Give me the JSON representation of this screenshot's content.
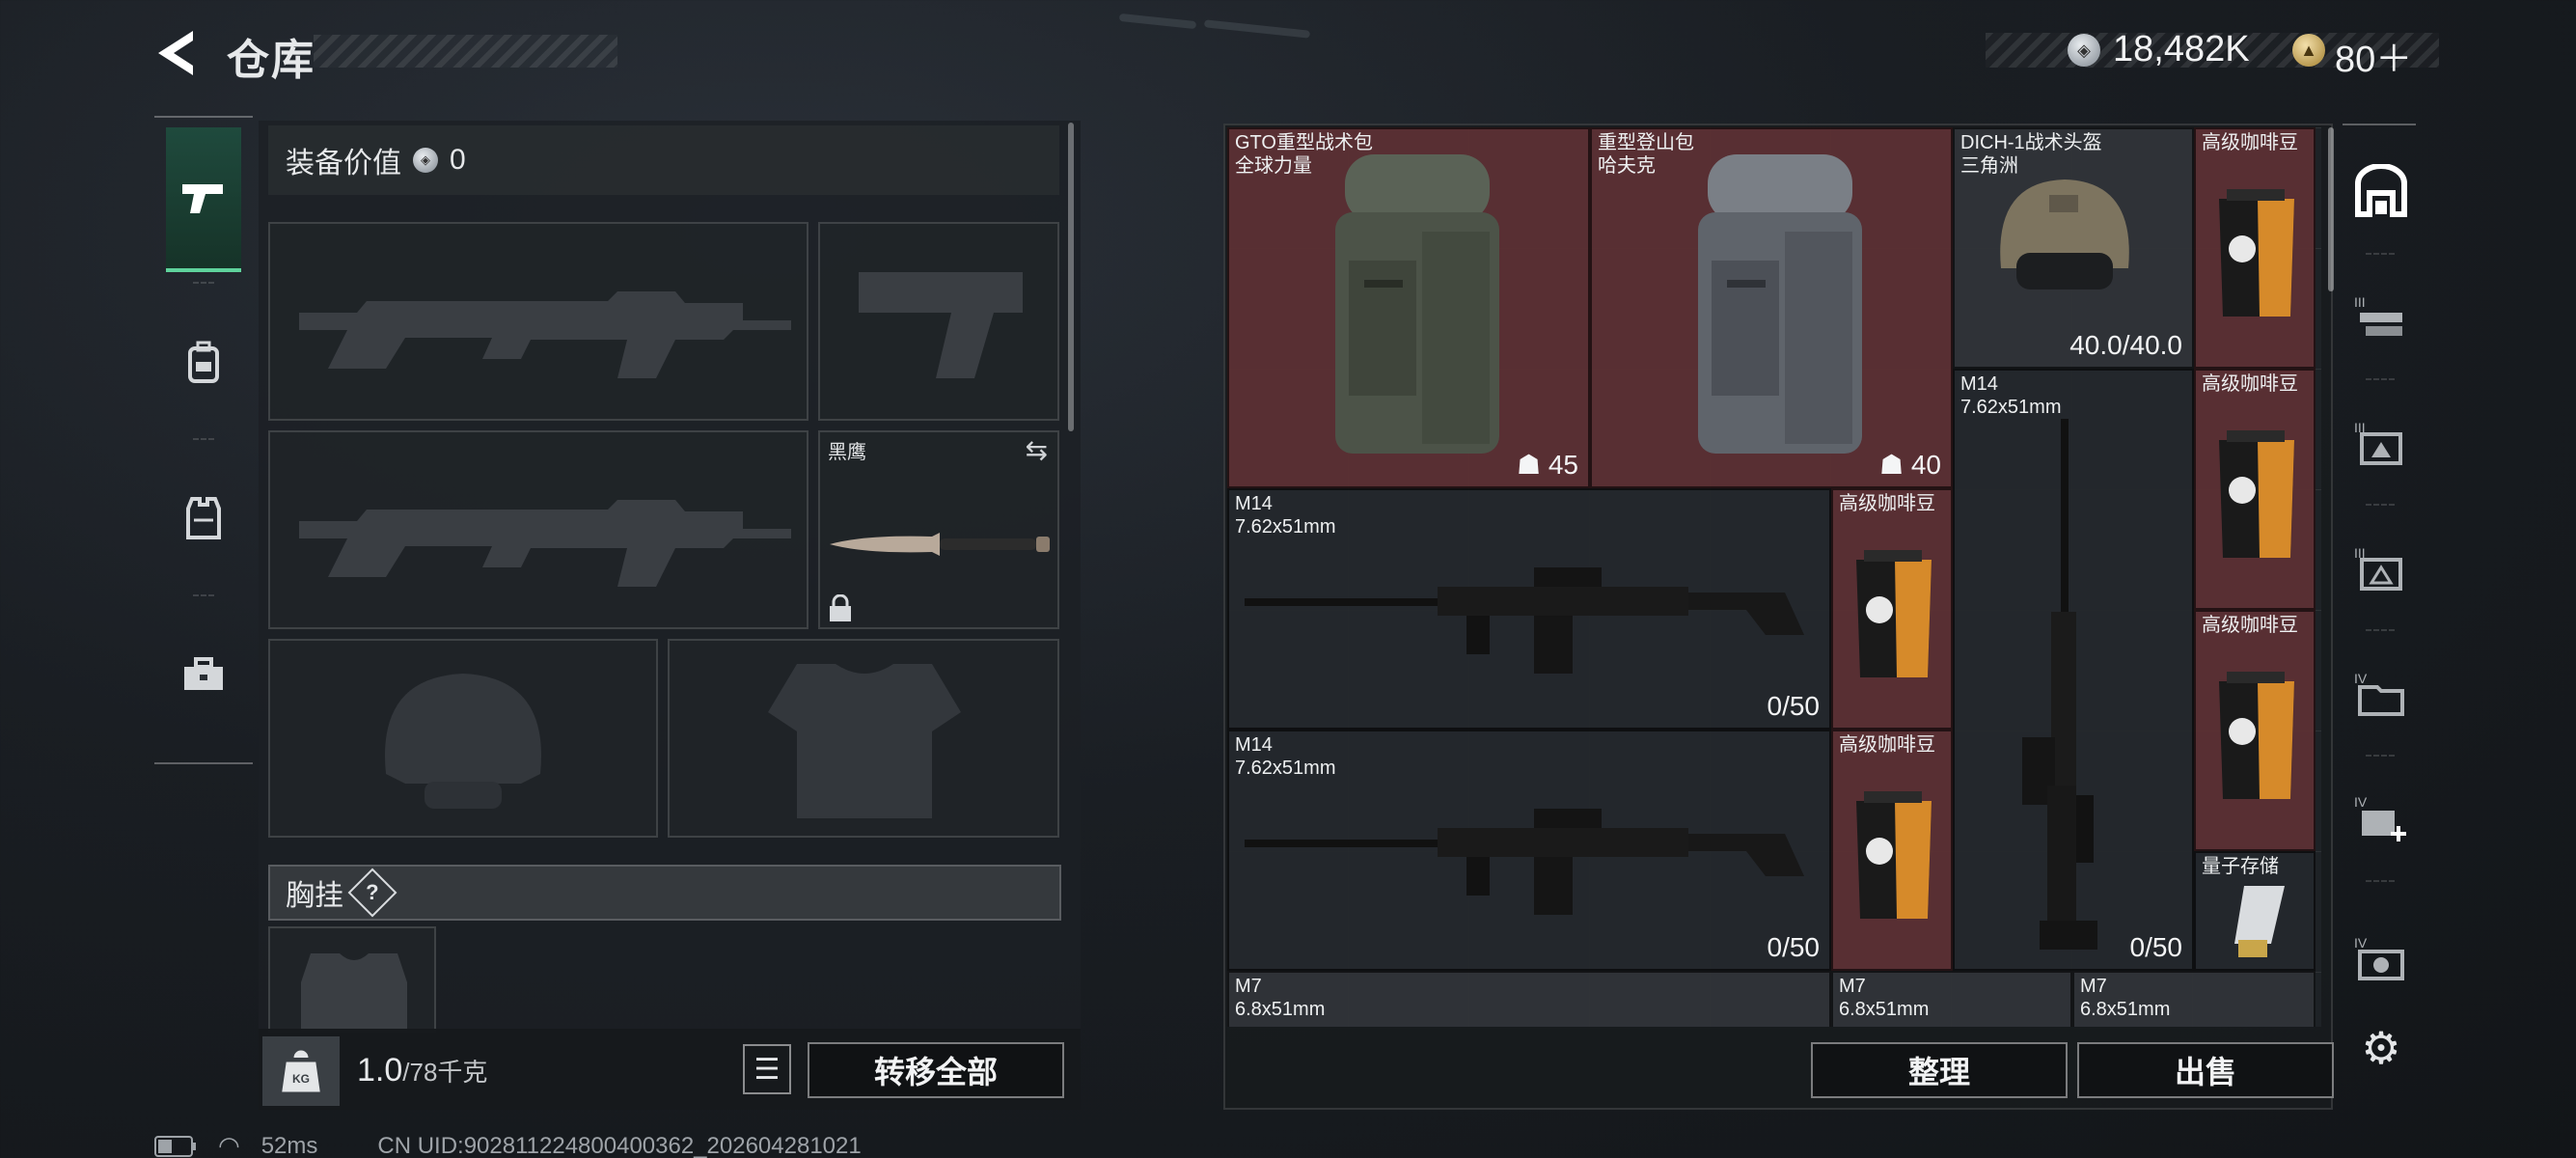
{
  "header": {
    "title": "仓库"
  },
  "currency": {
    "coins": "18,482K",
    "tickets": "80＋"
  },
  "left_nav": [
    {
      "icon": "pistol-icon",
      "active": true
    },
    {
      "icon": "backpack-icon",
      "active": false
    },
    {
      "icon": "vest-icon",
      "active": false
    },
    {
      "icon": "toolbox-icon",
      "active": false
    }
  ],
  "loadout": {
    "value_label": "装备价值",
    "value": "0",
    "melee_name": "黑鹰",
    "chest_label": "胸挂",
    "chest_help": "?",
    "weight_current": "1.0",
    "weight_max": "/78千克",
    "transfer_all": "转移全部"
  },
  "storage": {
    "items": [
      {
        "name": "GTO重型战术包",
        "sub": "全球力量",
        "count": "45"
      },
      {
        "name": "重型登山包",
        "sub": "哈夫克",
        "count": "40"
      },
      {
        "name": "DICH-1战术头盔",
        "sub": "三角洲",
        "durability": "40.0/40.0"
      },
      {
        "name": "高级咖啡豆"
      },
      {
        "name": "M14",
        "sub": "7.62x51mm"
      },
      {
        "name": "高级咖啡豆"
      },
      {
        "name": "M14",
        "sub": "7.62x51mm",
        "durability": "0/50"
      },
      {
        "name": "高级咖啡豆"
      },
      {
        "name": "高级咖啡豆"
      },
      {
        "name": "M14",
        "sub": "7.62x51mm",
        "durability": "0/50"
      },
      {
        "name": "高级咖啡豆"
      },
      {
        "name": "量子存储"
      },
      {
        "name": "M7",
        "sub": "6.8x51mm"
      },
      {
        "name": "M7",
        "sub": "6.8x51mm"
      },
      {
        "name": "M7",
        "sub": "6.8x51mm"
      }
    ],
    "vertical_m14_durability": "0/50",
    "sort_button": "整理",
    "sell_button": "出售"
  },
  "status_bar": {
    "ping": "52ms",
    "uid": "CN UID:902811224800400362_202604281021"
  }
}
